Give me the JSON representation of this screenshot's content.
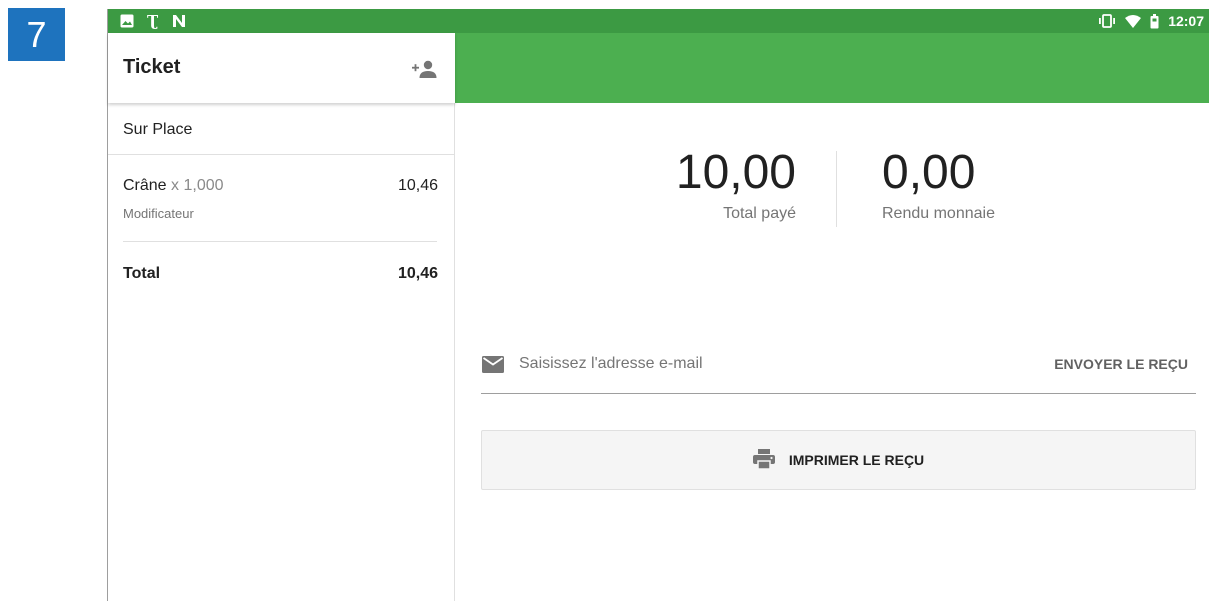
{
  "step_number": "7",
  "status_bar": {
    "time": "12:07",
    "left_icons": [
      "image-icon",
      "nyt-icon",
      "n-app-icon"
    ],
    "right_icons": [
      "vibrate-icon",
      "wifi-icon",
      "battery-icon"
    ]
  },
  "ticket": {
    "title": "Ticket",
    "add_customer_icon": "person-add-icon",
    "dining_option": "Sur Place",
    "items": [
      {
        "name": "Crâne",
        "qty": "x 1,000",
        "price": "10,46",
        "modifier": "Modificateur"
      }
    ],
    "total_label": "Total",
    "total_value": "10,46"
  },
  "payment": {
    "paid_value": "10,00",
    "paid_label": "Total payé",
    "change_value": "0,00",
    "change_label": "Rendu monnaie"
  },
  "receipt": {
    "email_placeholder": "Saisissez l'adresse e-mail",
    "email_value": "",
    "send_label": "ENVOYER LE REÇU",
    "print_label": "IMPRIMER LE REÇU"
  },
  "colors": {
    "status_bar": "#3c9a43",
    "header_green": "#4caf50",
    "badge_blue": "#1e73be"
  }
}
